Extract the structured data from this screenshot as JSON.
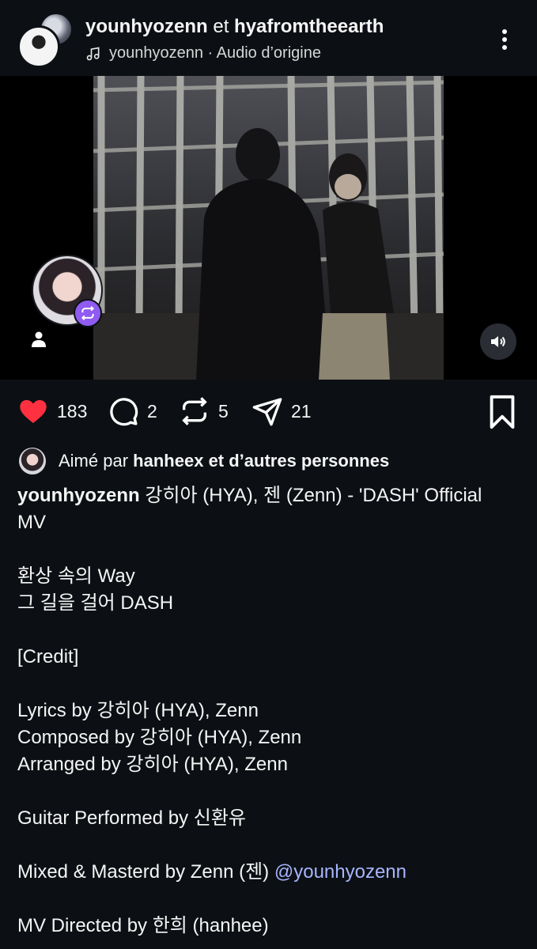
{
  "header": {
    "author_1": "younhyozenn",
    "joiner": "et",
    "author_2": "hyafromtheearth",
    "audio_text": "younhyozenn · Audio d’origine",
    "music_icon": "music-note-icon",
    "more_icon": "more-vertical-icon"
  },
  "media": {
    "sound_icon": "volume-on-icon",
    "tag_icon": "person-tag-icon",
    "remix_icon": "repost-icon"
  },
  "actions": {
    "likes": "183",
    "comments": "2",
    "reposts": "5",
    "shares": "21",
    "like_color": "#ff3040",
    "bookmark_icon": "bookmark-icon"
  },
  "liked_by": {
    "prefix": "Aimé par",
    "user": "hanheex",
    "suffix": "et d’autres personnes"
  },
  "caption": {
    "user": "younhyozenn",
    "title_line1": "강히아 (HYA), 젠 (Zenn) - 'DASH' Official",
    "title_line2": "MV",
    "lines": [
      "환상 속의 Way",
      "그 길을 걸어 DASH",
      "[Credit]",
      "Lyrics by 강히아 (HYA), Zenn",
      "Composed by 강히아 (HYA), Zenn",
      "Arranged by 강히아 (HYA), Zenn",
      "Guitar Performed by 신환유",
      "Mixed & Masterd by Zenn (젠)",
      "MV Directed by 한희 (hanhee)"
    ],
    "mention": "@younhyozenn",
    "mention_color": "#a8b4ff"
  }
}
